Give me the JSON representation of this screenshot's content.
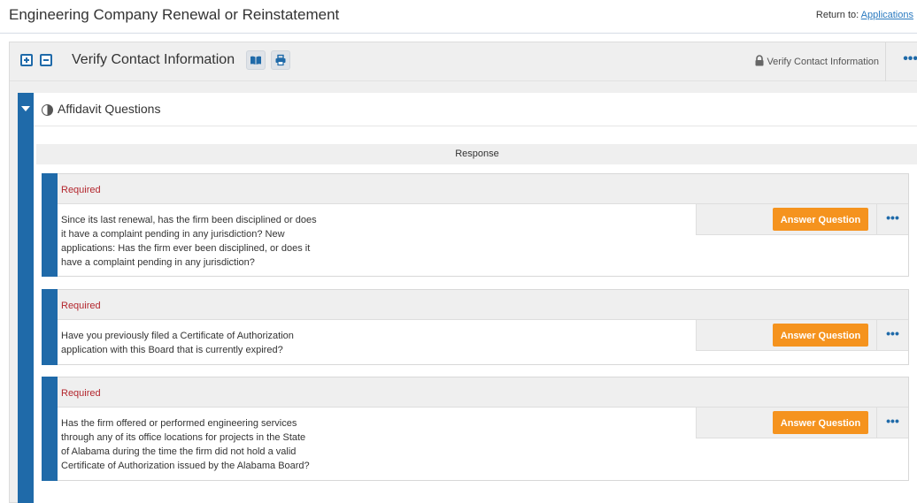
{
  "header": {
    "title": "Engineering Company Renewal or Reinstatement",
    "return_prefix": "Return to:",
    "return_link": "Applications"
  },
  "section": {
    "title": "Verify Contact Information",
    "lock_label": "Verify Contact Information",
    "icons": {
      "expand": "plus-square-icon",
      "collapse": "minus-square-icon",
      "book": "book-icon",
      "print": "printer-icon",
      "lock": "lock-icon",
      "menu": "more-dots-icon"
    }
  },
  "affidavit": {
    "title": "Affidavit Questions",
    "response_header": "Response",
    "icons": {
      "toggle": "caret-down-icon",
      "status": "half-circle-icon"
    }
  },
  "questions": [
    {
      "required_label": "Required",
      "lines": [
        "Since its last renewal, has the firm been disciplined or does",
        "it have a complaint pending in any jurisdiction? New",
        "applications: Has the firm ever been disciplined, or does it",
        "have a complaint pending in any jurisdiction?"
      ],
      "button_label": "Answer Question",
      "more_label": "•••"
    },
    {
      "required_label": "Required",
      "lines": [
        "Have you previously filed a Certificate of Authorization",
        "application with this Board that is currently expired?"
      ],
      "button_label": "Answer Question",
      "more_label": "•••"
    },
    {
      "required_label": "Required",
      "lines": [
        "Has the firm offered or performed engineering services",
        "through any of its office locations for projects in the State",
        "of Alabama during the time the firm did not hold a valid",
        "Certificate of Authorization issued by the Alabama Board?"
      ],
      "button_label": "Answer Question",
      "more_label": "•••"
    }
  ],
  "more_dots": "•••",
  "colors": {
    "accent_blue": "#1f6aa9",
    "button_orange": "#f5931e",
    "required_red": "#b3262d",
    "panel_gray": "#efefef"
  }
}
